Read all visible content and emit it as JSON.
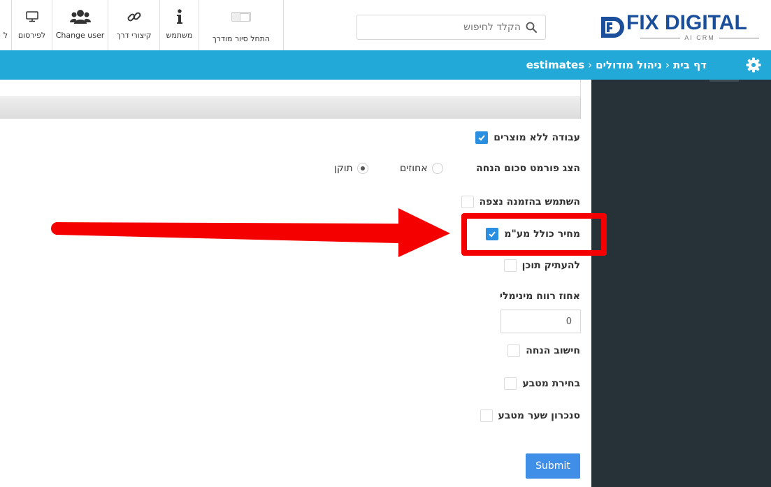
{
  "toolbar": {
    "items": [
      {
        "label": "ל",
        "icon": "truncated-icon"
      },
      {
        "label": "לפירסום",
        "icon": "monitor-icon"
      },
      {
        "label": "Change user",
        "icon": "users-icon"
      },
      {
        "label": "קיצורי דרך",
        "icon": "link-icon"
      },
      {
        "label": "משתמש",
        "icon": "info-icon"
      },
      {
        "label": "התחל סיור מודרך",
        "icon": "toggle-icon"
      }
    ]
  },
  "search": {
    "placeholder": "הקלד לחיפוש",
    "value": ""
  },
  "logo": {
    "word": "FIX DIGITAL",
    "tagline": "AI CRM"
  },
  "breadcrumb": {
    "home": "דף בית",
    "modules": "ניהול מודולים",
    "current": "estimates",
    "separator": "‹"
  },
  "form": {
    "work_without_products": {
      "label": "עבודה ללא מוצרים",
      "checked": true
    },
    "discount_format": {
      "label": "הצג פורמט סכום הנחה",
      "options": [
        {
          "label": "אחוזים",
          "selected": false
        },
        {
          "label": "תוקן",
          "selected": true
        }
      ]
    },
    "use_expected_order": {
      "label": "השתמש בהזמנה נצפה",
      "checked": false
    },
    "price_includes_vat": {
      "label": "מחיר כולל מע\"מ",
      "checked": true
    },
    "copy_content": {
      "label": "להעתיק תוכן",
      "checked": false
    },
    "min_profit": {
      "label": "אחוז רווח מינימלי",
      "value": "0"
    },
    "discount_calc": {
      "label": "חישוב הנחה",
      "checked": false
    },
    "currency_select": {
      "label": "בחירת מטבע",
      "checked": false
    },
    "currency_sync": {
      "label": "סנכרון שער מטבע",
      "checked": false
    },
    "submit_label": "Submit"
  },
  "colors": {
    "brand_blue": "#22a9d8",
    "sidebar_dark": "#263238",
    "checkbox_blue": "#2a8fe0",
    "submit_blue": "#3f8fe8",
    "annotation_red": "#f50000",
    "logo_blue": "#1b4f9c"
  }
}
